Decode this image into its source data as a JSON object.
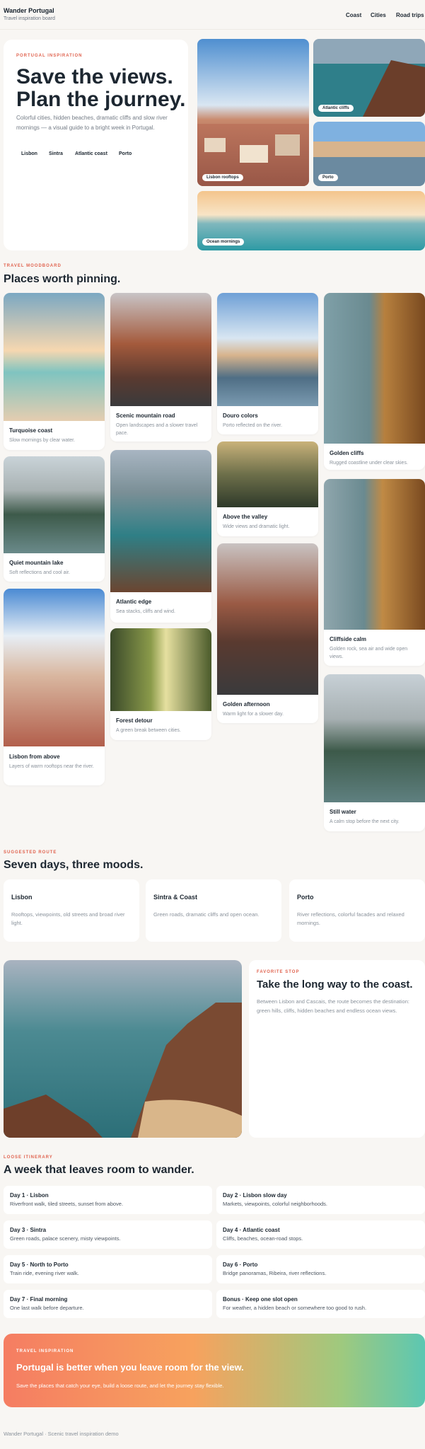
{
  "header": {
    "brand": "Wander Portugal",
    "subtitle": "Travel inspiration board",
    "nav": [
      "Coast",
      "Cities",
      "Road trips"
    ]
  },
  "hero": {
    "eyebrow": "Portugal inspiration",
    "title_line1": "Save the views.",
    "title_line2": "Plan the journey.",
    "text": "Colorful cities, hidden beaches, dramatic cliffs and slow river mornings — a visual guide to a bright week in Portugal.",
    "chips": [
      "Lisbon",
      "Sintra",
      "Atlantic coast",
      "Porto"
    ],
    "photos": [
      "Lisbon rooftops",
      "Atlantic cliffs",
      "Porto",
      "Ocean mornings"
    ]
  },
  "moodboard": {
    "eyebrow": "Travel moodboard",
    "title": "Places worth pinning.",
    "cards": [
      {
        "title": "Turquoise coast",
        "desc": "Slow mornings by clear water."
      },
      {
        "title": "Quiet mountain lake",
        "desc": "Soft reflections and cool air."
      },
      {
        "title": "Lisbon from above",
        "desc": "Layers of warm rooftops near the river."
      },
      {
        "title": "Scenic mountain road",
        "desc": "Open landscapes and a slower travel pace."
      },
      {
        "title": "Atlantic edge",
        "desc": "Sea stacks, cliffs and wind."
      },
      {
        "title": "Forest detour",
        "desc": "A green break between cities."
      },
      {
        "title": "Douro colors",
        "desc": "Porto reflected on the river."
      },
      {
        "title": "Above the valley",
        "desc": "Wide views and dramatic light."
      },
      {
        "title": "Golden afternoon",
        "desc": "Warm light for a slower day."
      },
      {
        "title": "Golden cliffs",
        "desc": "Rugged coastline under clear skies."
      },
      {
        "title": "Cliffside calm",
        "desc": "Golden rock, sea air and wide open views."
      },
      {
        "title": "Still water",
        "desc": "A calm stop before the next city."
      }
    ]
  },
  "route": {
    "eyebrow": "Suggested route",
    "title": "Seven days, three moods.",
    "cards": [
      {
        "title": "Lisbon",
        "desc": "Rooftops, viewpoints, old streets and broad river light."
      },
      {
        "title": "Sintra & Coast",
        "desc": "Green roads, dramatic cliffs and open ocean."
      },
      {
        "title": "Porto",
        "desc": "River reflections, colorful facades and relaxed mornings."
      }
    ]
  },
  "favorite": {
    "eyebrow": "Favorite stop",
    "title": "Take the long way to the coast.",
    "text": "Between Lisbon and Cascais, the route becomes the destination: green hills, cliffs, hidden beaches and endless ocean views."
  },
  "itinerary": {
    "eyebrow": "Loose itinerary",
    "title": "A week that leaves room to wander.",
    "days": [
      {
        "title": "Day 1 · Lisbon",
        "desc": "Riverfront walk, tiled streets, sunset from above."
      },
      {
        "title": "Day 2 · Lisbon slow day",
        "desc": "Markets, viewpoints, colorful neighborhoods."
      },
      {
        "title": "Day 3 · Sintra",
        "desc": "Green roads, palace scenery, misty viewpoints."
      },
      {
        "title": "Day 4 · Atlantic coast",
        "desc": "Cliffs, beaches, ocean-road stops."
      },
      {
        "title": "Day 5 · North to Porto",
        "desc": "Train ride, evening river walk."
      },
      {
        "title": "Day 6 · Porto",
        "desc": "Bridge panoramas, Ribeira, river reflections."
      },
      {
        "title": "Day 7 · Final morning",
        "desc": "One last walk before departure."
      },
      {
        "title": "Bonus · Keep one slot open",
        "desc": "For weather, a hidden beach or somewhere too good to rush."
      }
    ]
  },
  "cta": {
    "eyebrow": "Travel inspiration",
    "title": "Portugal is better when you leave room for the view.",
    "text": "Save the places that catch your eye, build a loose route, and let the journey stay flexible."
  },
  "footer": {
    "text": "Wander Portugal · Scenic travel inspiration demo"
  },
  "colors": {
    "accent": "#e0634f",
    "ink": "#1d2731",
    "muted": "#8a929b",
    "page": "#f8f6f3"
  }
}
